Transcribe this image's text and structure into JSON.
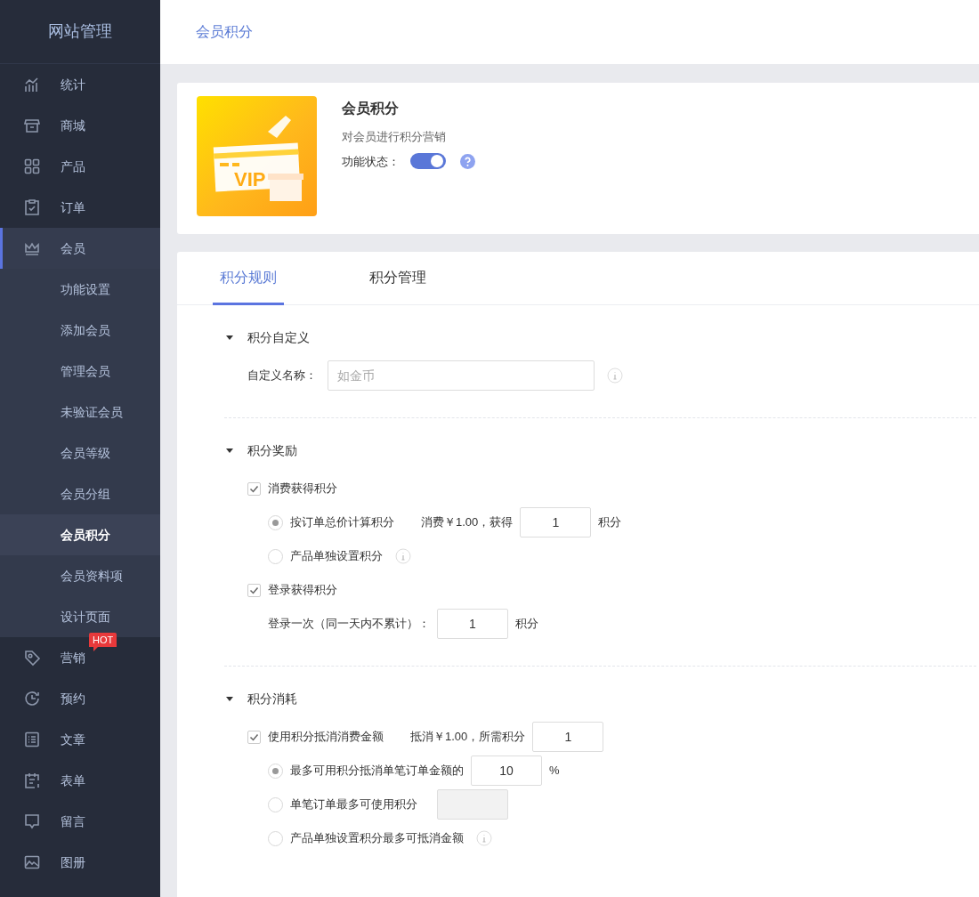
{
  "sidebar": {
    "title": "网站管理",
    "items": [
      {
        "label": "统计",
        "selected": false
      },
      {
        "label": "商城",
        "selected": false
      },
      {
        "label": "产品",
        "selected": false
      },
      {
        "label": "订单",
        "selected": false
      },
      {
        "label": "会员",
        "selected": true,
        "expanded": true,
        "children": [
          {
            "label": "功能设置",
            "selected": false
          },
          {
            "label": "添加会员",
            "selected": false
          },
          {
            "label": "管理会员",
            "selected": false
          },
          {
            "label": "未验证会员",
            "selected": false
          },
          {
            "label": "会员等级",
            "selected": false
          },
          {
            "label": "会员分组",
            "selected": false
          },
          {
            "label": "会员积分",
            "selected": true
          },
          {
            "label": "会员资料项",
            "selected": false
          },
          {
            "label": "设计页面",
            "selected": false
          }
        ]
      },
      {
        "label": "营销",
        "selected": false,
        "badge": "HOT"
      },
      {
        "label": "预约",
        "selected": false
      },
      {
        "label": "文章",
        "selected": false
      },
      {
        "label": "表单",
        "selected": false
      },
      {
        "label": "留言",
        "selected": false
      },
      {
        "label": "图册",
        "selected": false
      }
    ]
  },
  "header": {
    "title": "会员积分"
  },
  "feature": {
    "illustration_text": "VIP",
    "title": "会员积分",
    "description": "对会员进行积分营销",
    "status_label": "功能状态：",
    "enabled": true
  },
  "tabs": [
    {
      "label": "积分规则",
      "selected": true
    },
    {
      "label": "积分管理",
      "selected": false
    }
  ],
  "sections": [
    {
      "title": "积分自定义",
      "expanded": true,
      "rows": [
        {
          "kind": "field",
          "label": "自定义名称：",
          "placeholder": "如金币",
          "info": true
        }
      ]
    },
    {
      "title": "积分奖励",
      "expanded": true,
      "rows": [
        {
          "kind": "checkbox",
          "label": "消费获得积分",
          "checked": true,
          "children": [
            {
              "kind": "radio",
              "label": "按订单总价计算积分",
              "selected": true,
              "text": "消费￥1.00，获得",
              "input": {
                "value": "1",
                "disabled": false
              },
              "unit": "积分"
            },
            {
              "kind": "radio",
              "label": "产品单独设置积分",
              "selected": false,
              "info": true
            }
          ]
        },
        {
          "kind": "checkbox",
          "label": "登录获得积分",
          "checked": true,
          "children": [
            {
              "kind": "line",
              "text": "登录一次（同一天内不累计）：",
              "input": {
                "value": "1",
                "disabled": false
              },
              "unit": "积分"
            }
          ]
        }
      ]
    },
    {
      "title": "积分消耗",
      "expanded": true,
      "rows": [
        {
          "kind": "checkbox",
          "label": "使用积分抵消消费金额",
          "checked": true,
          "text": "抵消￥1.00，所需积分",
          "input": {
            "value": "1",
            "disabled": false
          },
          "children": [
            {
              "kind": "radio",
              "label": "最多可用积分抵消单笔订单金额的",
              "selected": true,
              "input": {
                "value": "10",
                "disabled": false
              },
              "unit": "%"
            },
            {
              "kind": "radio",
              "label": "单笔订单最多可使用积分",
              "selected": false,
              "input": {
                "disabled": true
              }
            },
            {
              "kind": "radio",
              "label": "产品单独设置积分最多可抵消金额",
              "selected": false,
              "info": true
            }
          ]
        }
      ]
    }
  ]
}
